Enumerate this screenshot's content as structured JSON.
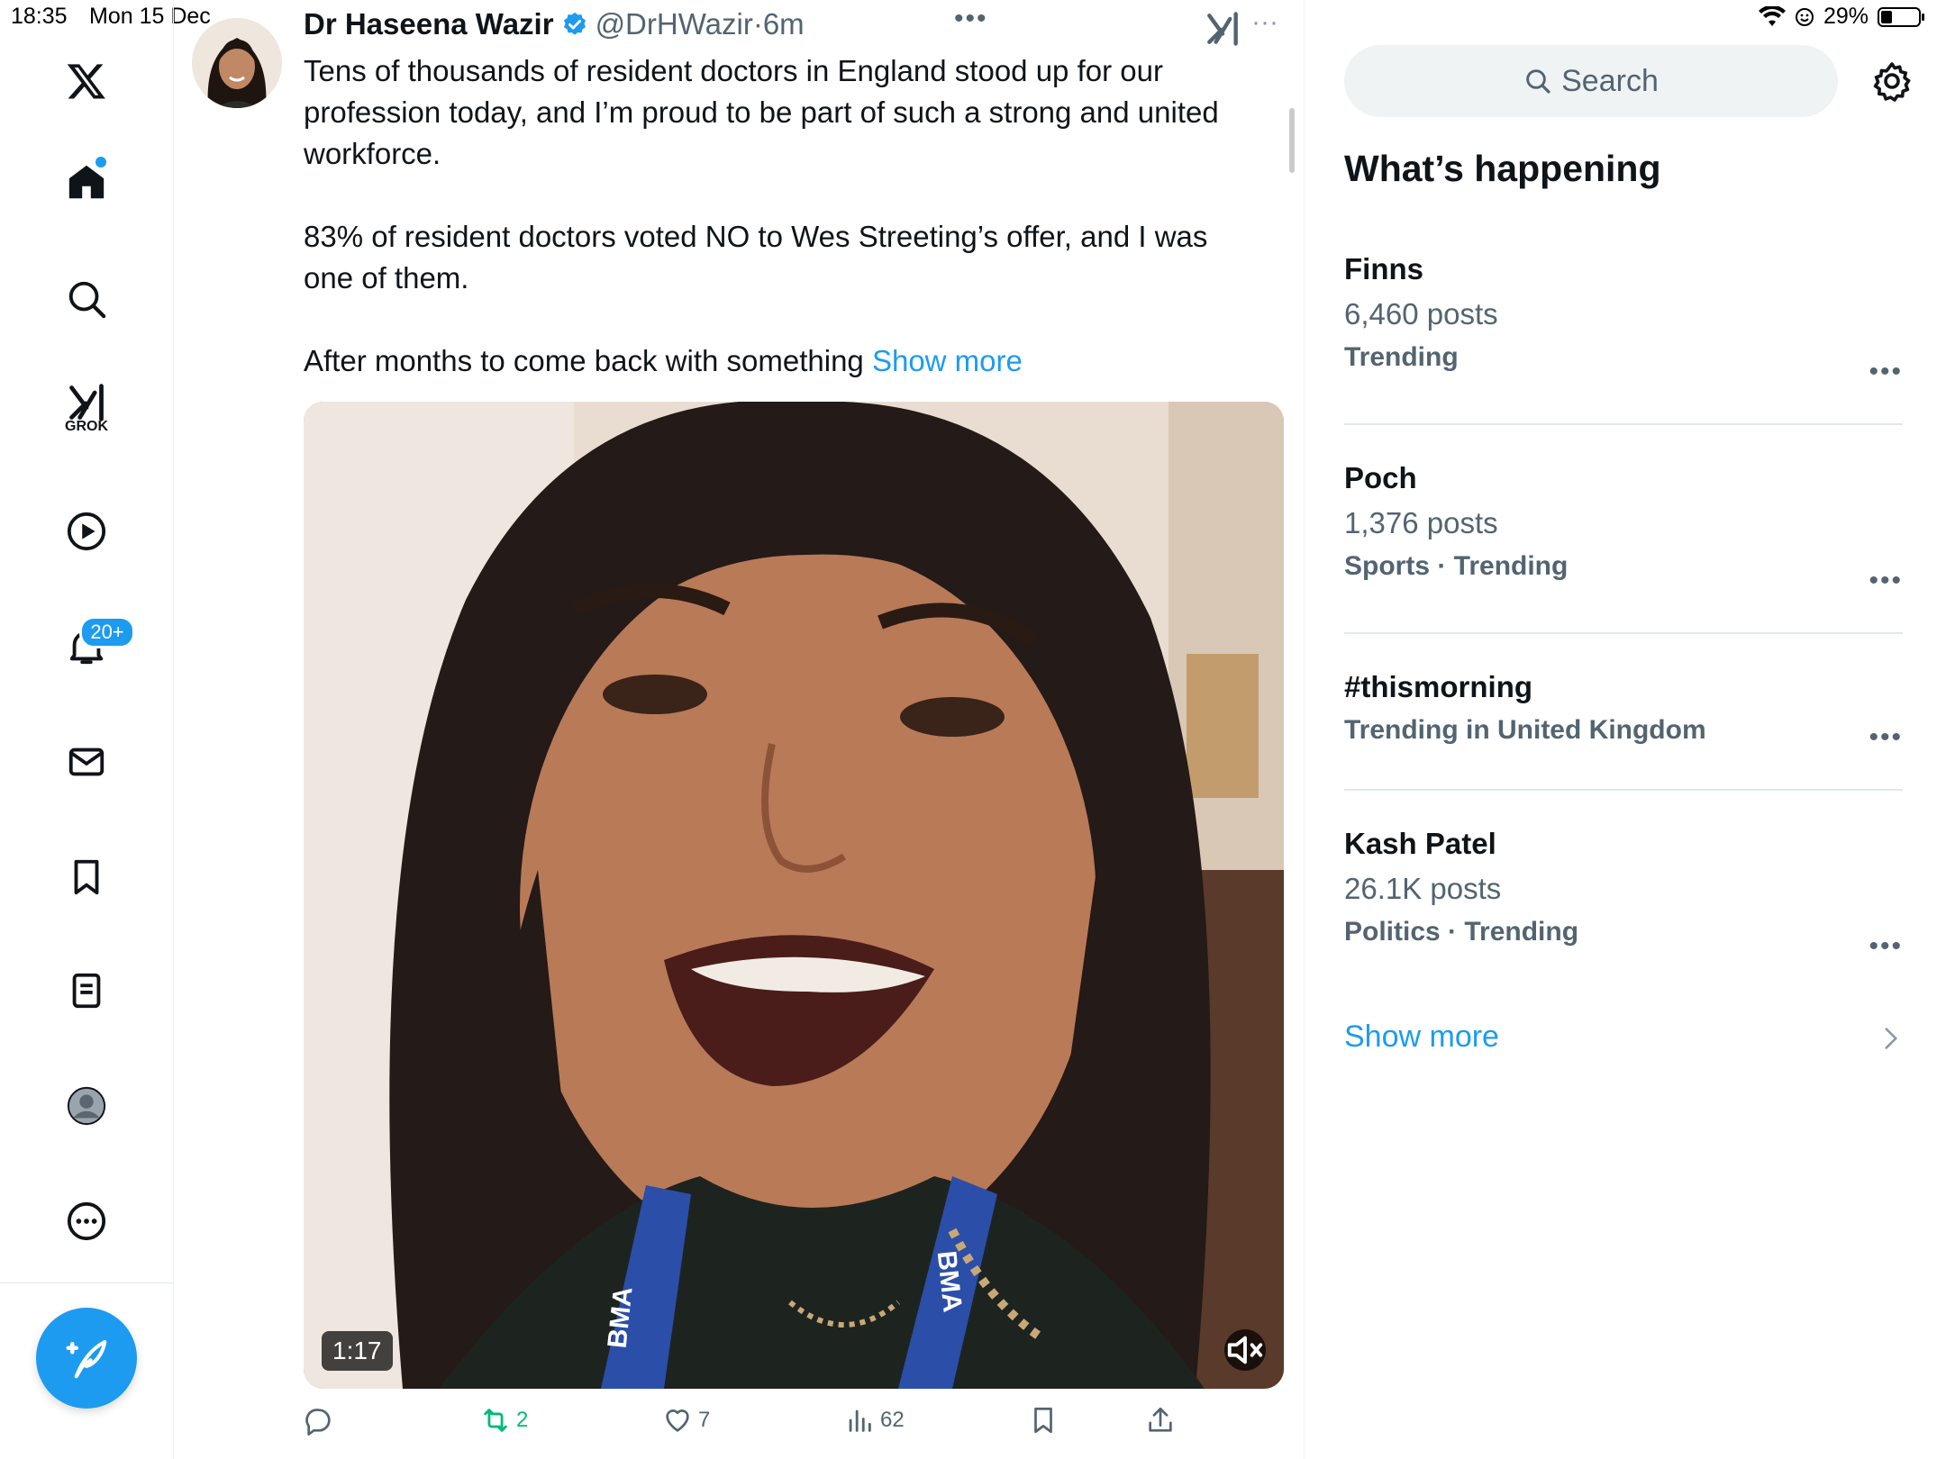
{
  "status_bar": {
    "time": "18:35",
    "date": "Mon 15 Dec",
    "battery": "29%",
    "battery_level": 0.29
  },
  "sidebar": {
    "notifications_badge": "20+",
    "grok_label": "GROK",
    "items": [
      {
        "name": "x-logo-icon"
      },
      {
        "name": "home-icon"
      },
      {
        "name": "search-icon"
      },
      {
        "name": "grok-icon"
      },
      {
        "name": "video-icon"
      },
      {
        "name": "notifications-icon"
      },
      {
        "name": "messages-icon"
      },
      {
        "name": "bookmarks-icon"
      },
      {
        "name": "lists-icon"
      },
      {
        "name": "profile-icon"
      },
      {
        "name": "more-icon"
      }
    ],
    "compose_icon": "compose-post-icon"
  },
  "tweet": {
    "author_name": "Dr Haseena Wazir",
    "handle": "@DrHWazir",
    "time": "6m",
    "paragraph_1": "Tens of thousands of resident doctors in England stood up for our profession today, and I’m proud to be part of such a strong and united workforce.",
    "paragraph_2": "83% of resident doctors voted NO to Wes Streeting’s offer, and I was one of them.",
    "paragraph_3": "After months to come back with something",
    "show_more": "Show more",
    "video_duration": "1:17",
    "lanyard_text": "BMA",
    "actions": {
      "replies": "",
      "reposts": "2",
      "likes": "7",
      "views": "62"
    }
  },
  "right_panel": {
    "search_placeholder": "Search",
    "section_title": "What’s happening",
    "trends": [
      {
        "title": "Finns",
        "count": "6,460 posts",
        "meta": "Trending"
      },
      {
        "title": "Poch",
        "count": "1,376 posts",
        "meta": "Sports · Trending"
      },
      {
        "title": "#thismorning",
        "count": "",
        "meta": "Trending in United Kingdom"
      },
      {
        "title": "Kash Patel",
        "count": "26.1K posts",
        "meta": "Politics · Trending"
      }
    ],
    "show_more": "Show more"
  },
  "colors": {
    "accent": "#1d9bf0",
    "repost": "#00ba7c",
    "secondary_text": "#536471"
  }
}
